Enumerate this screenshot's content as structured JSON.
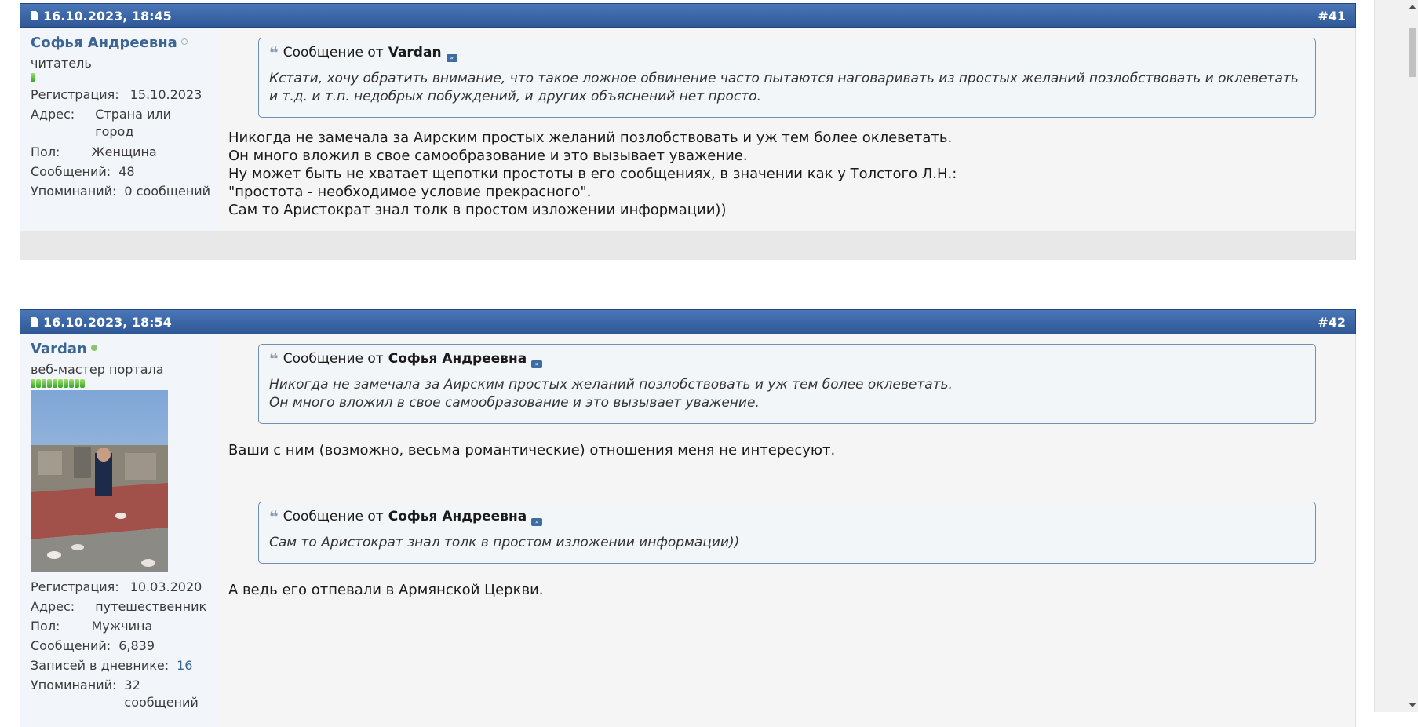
{
  "posts": [
    {
      "date": "16.10.2023, 18:45",
      "number": "#41",
      "user": {
        "name": "Софья Андреевна",
        "title": "читатель",
        "online": false,
        "rep_bars": 1,
        "fields": [
          {
            "label": "Регистрация:",
            "value": "15.10.2023"
          },
          {
            "label": "Адрес:",
            "value": "Страна или город"
          },
          {
            "label": "Пол:",
            "value": "Женщина"
          },
          {
            "label": "Сообщений:",
            "value": "48"
          },
          {
            "label": "Упоминаний:",
            "value": "0 сообщений"
          }
        ]
      },
      "quote": {
        "prefix": "Сообщение от",
        "author": "Vardan",
        "text": "Кстати, хочу обратить внимание, что такое ложное обвинение часто пытаются наговаривать из простых желаний позлобствовать и оклеветать и т.д. и т.п. недобрых побуждений, и других объяснений нет просто."
      },
      "message": [
        "Никогда не замечала за Аирским простых желаний позлобствовать и уж тем более оклеветать.",
        "Он много вложил в свое самообразование и это вызывает уважение.",
        "Ну может быть не хватает щепотки простоты в его сообщениях, в значении как у Толстого Л.Н.:",
        "\"простота - необходимое условие прекрасного\".",
        "Сам то Аристократ знал толк в простом изложении информации))"
      ]
    },
    {
      "date": "16.10.2023, 18:54",
      "number": "#42",
      "user": {
        "name": "Vardan",
        "title": "веб-мастер портала",
        "online": true,
        "rep_bars": 10,
        "fields": [
          {
            "label": "Регистрация:",
            "value": "10.03.2020"
          },
          {
            "label": "Адрес:",
            "value": "путешественник"
          },
          {
            "label": "Пол:",
            "value": "Мужчина"
          },
          {
            "label": "Сообщений:",
            "value": "6,839"
          },
          {
            "label": "Записей в дневнике:",
            "value": "16"
          },
          {
            "label": "Упоминаний:",
            "value": "32 сообщений"
          }
        ]
      },
      "quote1": {
        "prefix": "Сообщение от",
        "author": "Софья Андреевна",
        "lines": [
          "Никогда не замечала за Аирским простых желаний позлобствовать и уж тем более оклеветать.",
          "Он много вложил в свое самообразование и это вызывает уважение."
        ]
      },
      "reply1": "Ваши с ним (возможно, весьма романтические) отношения меня не интересуют.",
      "quote2": {
        "prefix": "Сообщение от",
        "author": "Софья Андреевна",
        "text": "Сам то Аристократ знал толк в простом изложении информации))"
      },
      "reply2": "А ведь его отпевали в Армянской Церкви."
    }
  ]
}
